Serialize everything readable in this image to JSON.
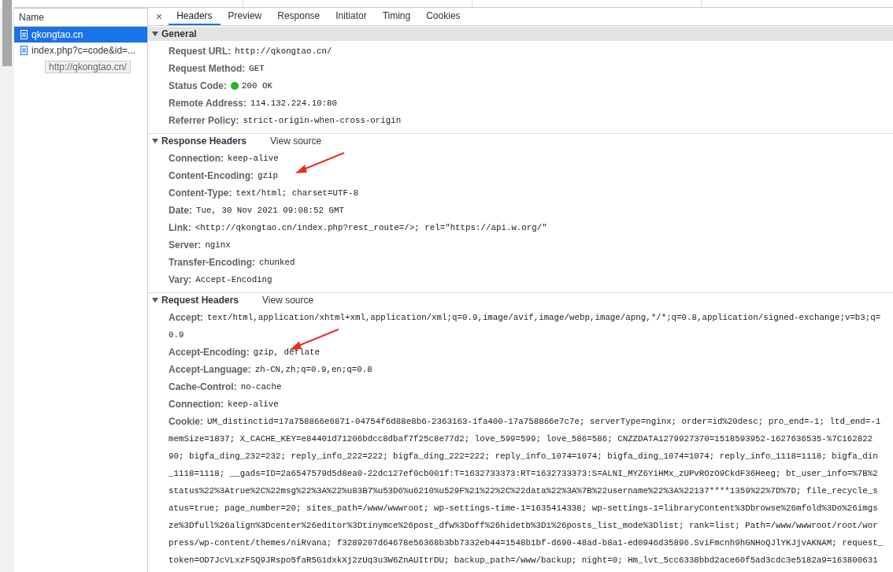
{
  "requests_panel": {
    "header": "Name",
    "requests": [
      {
        "name": "qkongtao.cn",
        "selected": true
      },
      {
        "name": "index.php?c=code&id=...",
        "selected": false
      }
    ],
    "tooltip": "http://qkongtao.cn/"
  },
  "close_button": "×",
  "tabs": [
    {
      "label": "Headers",
      "selected": true
    },
    {
      "label": "Preview",
      "selected": false
    },
    {
      "label": "Response",
      "selected": false
    },
    {
      "label": "Initiator",
      "selected": false
    },
    {
      "label": "Timing",
      "selected": false
    },
    {
      "label": "Cookies",
      "selected": false
    }
  ],
  "sections": [
    {
      "title": "General",
      "expanded": true,
      "rows": [
        {
          "key": "Request URL:",
          "value": "http://qkongtao.cn/"
        },
        {
          "key": "Request Method:",
          "value": "GET"
        },
        {
          "key": "Status Code:",
          "value": "200 OK",
          "color": "#1fb52a"
        },
        {
          "key": "Remote Address:",
          "value": "114.132.224.10:80"
        },
        {
          "key": "Referrer Policy:",
          "value": "strict-origin-when-cross-origin"
        }
      ]
    },
    {
      "title": "Response Headers",
      "expanded": true,
      "link": "View source",
      "rows": [
        {
          "key": "Connection:",
          "value": "keep-alive"
        },
        {
          "key": "Content-Encoding:",
          "value": "gzip",
          "arrow": true
        },
        {
          "key": "Content-Type:",
          "value": "text/html; charset=UTF-8"
        },
        {
          "key": "Date:",
          "value": "Tue, 30 Nov 2021 09:08:52 GMT"
        },
        {
          "key": "Link:",
          "value": "<http://qkongtao.cn/index.php?rest_route=/>; rel=\"https://api.w.org/\""
        },
        {
          "key": "Server:",
          "value": "nginx"
        },
        {
          "key": "Transfer-Encoding:",
          "value": "chunked"
        },
        {
          "key": "Vary:",
          "value": "Accept-Encoding"
        }
      ]
    },
    {
      "title": "Request Headers",
      "expanded": true,
      "link": "View source",
      "rows": [
        {
          "key": "Accept:",
          "lines": [
            "text/html,application/xhtml+xml,application/xml;q=0.9,image/avif,image/webp,image/apng,*/*;q=0.8,application/signed-exchange;v=b3;q=",
            "0.9"
          ]
        },
        {
          "key": "Accept-Encoding:",
          "value": "gzip, deflate",
          "arrow": true
        },
        {
          "key": "Accept-Language:",
          "value": "zh-CN,zh;q=0.9,en;q=0.8"
        },
        {
          "key": "Cache-Control:",
          "value": "no-cache"
        },
        {
          "key": "Connection:",
          "value": "keep-alive"
        },
        {
          "key": "Cookie:",
          "lines": [
            "UM_distinctid=17a758866e6871-04754f6d88e8b6-2363163-1fa400-17a758866e7c7e; serverType=nginx; order=id%20desc; pro_end=-1; ltd_end=-1",
            "memSize=1837; X_CACHE_KEY=e84401d71206bdcc8dbaf7f25c8e77d2; love_599=599; love_586=586; CNZZDATA1279927370=1518593952-1627636535-%7C162822",
            "90; bigfa_ding_232=232; reply_info_222=222; bigfa_ding_222=222; reply_info_1074=1074; bigfa_ding_1074=1074; reply_info_1118=1118; bigfa_din",
            "_1118=1118; __gads=ID=2a6547579d5d8ea0-22dc127ef0cb001f:T=1632733373:RT=1632733373:S=ALNI_MYZ6YiHMx_zUPvROzO9CkdF36Heeg; bt_user_info=%7B%2",
            "status%22%3Atrue%2C%22msg%22%3A%22%u83B7%u53D6%u6210%u529F%21%22%2C%22data%22%3A%7B%22username%22%3A%22137****1359%22%7D%7D; file_recycle_s",
            "atus=true; page_number=20; sites_path=/www/wwwroot; wp-settings-time-1=1635414338; wp-settings-1=libraryContent%3Dbrowse%26mfold%3Do%26imgs",
            "ze%3Dfull%26align%3Dcenter%26editor%3Dtinymce%26post_dfw%3Doff%26hidetb%3D1%26posts_list_mode%3Dlist; rank=list; Path=/www/wwwroot/root/wor",
            "press/wp-content/themes/niRvana; f3289207d64678e56368b3bb7332eb44=1548b1bf-d690-48ad-b8a1-ed0946d35896.SviFmcnh9hGNHoQJlYKJjvAKNAM; request_",
            "token=OD7JcVLxzFSQ9JRspo5faR5G1dxkXj2zUq3u3W6ZnAUItrDU; backup_path=/www/backup; night=0; Hm_lvt_5cc6338bbd2ace60f5ad3cdc3e5182a9=163800631"
          ]
        }
      ]
    }
  ]
}
